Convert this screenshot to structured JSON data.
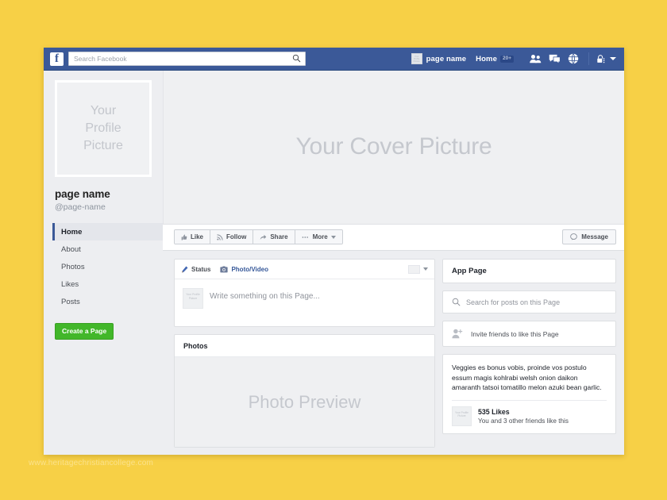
{
  "watermark": "www.heritagechristiancollege.com",
  "colors": {
    "page_background": "#f7d046",
    "facebook_blue": "#3b5998",
    "create_green": "#42b72a",
    "link_blue": "#365899"
  },
  "navbar": {
    "logo": "f",
    "search_placeholder": "Search Facebook",
    "search_value": "",
    "page_thumb_text": "Your Profile Picture",
    "page_name": "page name",
    "home_label": "Home",
    "home_badge": "20+",
    "icons": [
      "friends-icon",
      "messages-icon",
      "globe-icon",
      "privacy-lock-icon",
      "chevron-down-icon"
    ]
  },
  "sidebar": {
    "profile_picture_lines": [
      "Your",
      "Profile",
      "Picture"
    ],
    "page_name": "page name",
    "page_handle": "@page-name",
    "items": [
      {
        "label": "Home",
        "active": true
      },
      {
        "label": "About",
        "active": false
      },
      {
        "label": "Photos",
        "active": false
      },
      {
        "label": "Likes",
        "active": false
      },
      {
        "label": "Posts",
        "active": false
      }
    ],
    "create_button": "Create a Page"
  },
  "cover": {
    "text": "Your Cover Picture"
  },
  "action_bar": {
    "buttons": [
      {
        "label": "Like",
        "icon": "thumbs-up-icon"
      },
      {
        "label": "Follow",
        "icon": "rss-icon"
      },
      {
        "label": "Share",
        "icon": "share-arrow-icon"
      },
      {
        "label": "More",
        "icon": "ellipsis-icon"
      }
    ],
    "message_label": "Message"
  },
  "composer": {
    "tabs": [
      {
        "label": "Status",
        "icon": "pencil-icon",
        "active": true
      },
      {
        "label": "Photo/Video",
        "icon": "camera-icon",
        "active": false
      }
    ],
    "avatar_text": "Your Profile Picture",
    "placeholder": "Write something on this Page..."
  },
  "photos_section": {
    "title": "Photos",
    "preview_text": "Photo Preview"
  },
  "side_column": {
    "app_page_title": "App Page",
    "search_placeholder": "Search for posts on this Page",
    "invite_label": "Invite friends to like this Page",
    "post": {
      "text": "Veggies es bonus vobis, proinde vos postulo essum magis kohlrabi welsh onion daikon amaranth tatsoi tomatillo melon azuki bean garlic.",
      "avatar_text": "Your Profile Picture",
      "likes_count": "535 Likes",
      "likes_sub": "You and 3 other friends like this"
    }
  }
}
